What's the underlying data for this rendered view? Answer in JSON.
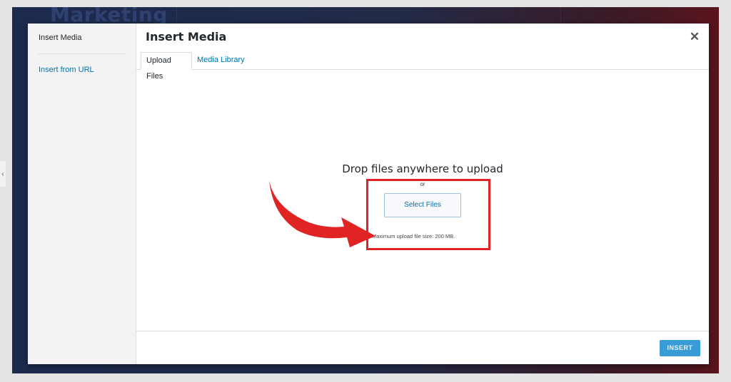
{
  "background": {
    "title": "Marketing"
  },
  "menu": {
    "title": "Insert Media",
    "items": [
      {
        "label": "Insert from URL"
      }
    ]
  },
  "modal": {
    "title": "Insert Media",
    "close_icon": "close-icon"
  },
  "tabs": [
    {
      "label": "Upload Files",
      "active": true
    },
    {
      "label": "Media Library",
      "active": false
    }
  ],
  "upload": {
    "heading": "Drop files anywhere to upload",
    "or": "or",
    "select_button": "Select Files",
    "max_size": "Maximum upload file size: 200 MB."
  },
  "toolbar": {
    "insert_label": "INSERT"
  },
  "colors": {
    "accent": "#0073aa",
    "highlight": "#e02424",
    "insert_button": "#3a9cd6"
  }
}
